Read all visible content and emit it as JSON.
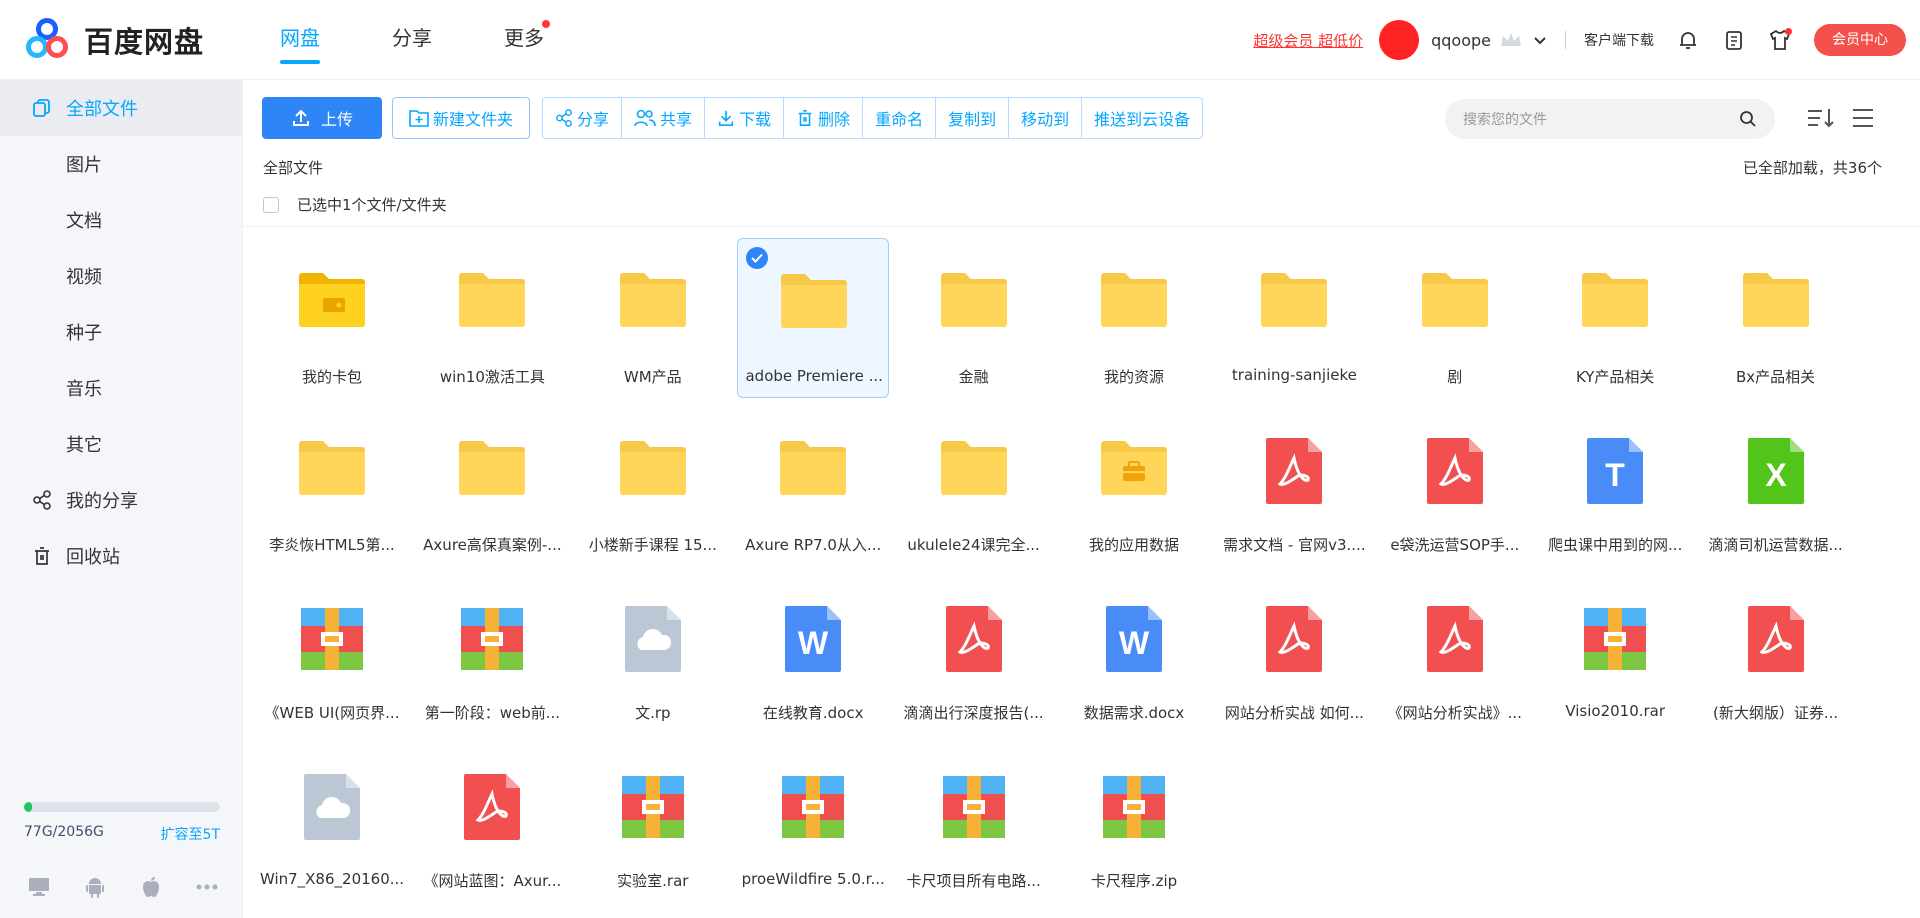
{
  "app": {
    "logo_text": "百度网盘"
  },
  "topnav": {
    "items": [
      {
        "label": "网盘",
        "active": true
      },
      {
        "label": "分享"
      },
      {
        "label": "更多",
        "badge": true
      }
    ]
  },
  "topright": {
    "promo": "超级会员 超低价",
    "username": "qqoope",
    "client_download": "客户端下载",
    "vip_center": "会员中心"
  },
  "sidebar": {
    "items": [
      {
        "label": "全部文件",
        "active": true,
        "icon": "files-icon"
      },
      {
        "label": "图片"
      },
      {
        "label": "文档"
      },
      {
        "label": "视频"
      },
      {
        "label": "种子"
      },
      {
        "label": "音乐"
      },
      {
        "label": "其它"
      },
      {
        "label": "我的分享",
        "icon": "share-icon"
      },
      {
        "label": "回收站",
        "icon": "trash-icon"
      }
    ],
    "storage": {
      "used_text": "77G/2056G",
      "expand": "扩容至5T",
      "used_fraction": 0.04
    }
  },
  "toolbar": {
    "upload": "上传",
    "new_folder": "新建文件夹",
    "group": [
      {
        "label": "分享",
        "icon": "share-icon"
      },
      {
        "label": "共享",
        "icon": "people-icon"
      },
      {
        "label": "下载",
        "icon": "download-icon"
      },
      {
        "label": "删除",
        "icon": "trash-icon"
      },
      {
        "label": "重命名"
      },
      {
        "label": "复制到"
      },
      {
        "label": "移动到"
      },
      {
        "label": "推送到云设备"
      }
    ]
  },
  "search": {
    "placeholder": "搜索您的文件"
  },
  "breadcrumb": "全部文件",
  "loaded_text": "已全部加载，共36个",
  "selection_text": "已选中1个文件/文件夹",
  "files": [
    {
      "name": "我的卡包",
      "type": "folder-card"
    },
    {
      "name": "win10激活工具",
      "type": "folder"
    },
    {
      "name": "WM产品",
      "type": "folder"
    },
    {
      "name": "adobe Premiere ...",
      "type": "folder",
      "selected": true
    },
    {
      "name": "金融",
      "type": "folder"
    },
    {
      "name": "我的资源",
      "type": "folder"
    },
    {
      "name": "training-sanjieke",
      "type": "folder"
    },
    {
      "name": "剧",
      "type": "folder"
    },
    {
      "name": "KY产品相关",
      "type": "folder"
    },
    {
      "name": "Bx产品相关",
      "type": "folder"
    },
    {
      "name": "李炎恢HTML5第...",
      "type": "folder"
    },
    {
      "name": "Axure高保真案例-...",
      "type": "folder"
    },
    {
      "name": "小楼新手课程 15...",
      "type": "folder"
    },
    {
      "name": "Axure RP7.0从入...",
      "type": "folder"
    },
    {
      "name": "ukulele24课完全...",
      "type": "folder"
    },
    {
      "name": "我的应用数据",
      "type": "folder-app"
    },
    {
      "name": "需求文档 - 官网v3....",
      "type": "pdf"
    },
    {
      "name": "e袋洗运营SOP手...",
      "type": "pdf"
    },
    {
      "name": "爬虫课中用到的网...",
      "type": "txt"
    },
    {
      "name": "滴滴司机运营数据...",
      "type": "xls"
    },
    {
      "name": "《WEB UI(网页界...",
      "type": "rar"
    },
    {
      "name": "第一阶段：web前...",
      "type": "rar"
    },
    {
      "name": "文.rp",
      "type": "cloud"
    },
    {
      "name": "在线教育.docx",
      "type": "doc"
    },
    {
      "name": "滴滴出行深度报告(...",
      "type": "pdf"
    },
    {
      "name": "数据需求.docx",
      "type": "doc"
    },
    {
      "name": "网站分析实战 如何...",
      "type": "pdf"
    },
    {
      "name": "《网站分析实战》...",
      "type": "pdf"
    },
    {
      "name": "Visio2010.rar",
      "type": "rar"
    },
    {
      "name": "(新大纲版）证券...",
      "type": "pdf"
    },
    {
      "name": "Win7_X86_20160...",
      "type": "cloud"
    },
    {
      "name": "《网站蓝图：Axur...",
      "type": "pdf"
    },
    {
      "name": "实验室.rar",
      "type": "rar"
    },
    {
      "name": "proeWildfire 5.0.r...",
      "type": "rar"
    },
    {
      "name": "卡尺项目所有电路...",
      "type": "rar"
    },
    {
      "name": "卡尺程序.zip",
      "type": "rar"
    }
  ],
  "colors": {
    "accent": "#06a7ff",
    "primary_button": "#2e85f7",
    "folder": "#ffd659",
    "pdf": "#f25050",
    "doc": "#4a8cf7",
    "xls": "#52c41a",
    "vip": "#f2504b"
  }
}
